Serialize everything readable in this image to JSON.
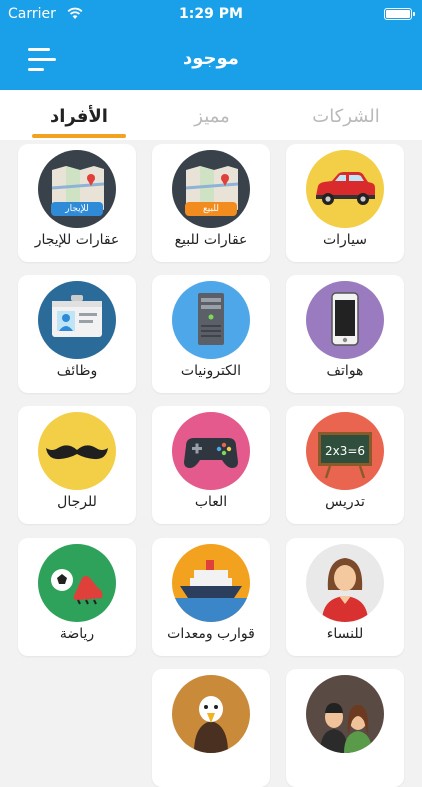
{
  "status_bar": {
    "carrier": "Carrier",
    "time": "1:29 PM"
  },
  "navbar": {
    "title": "موجود"
  },
  "tabs": [
    {
      "label": "الشركات"
    },
    {
      "label": "مميز"
    },
    {
      "label": "الأفراد"
    }
  ],
  "categories": [
    {
      "label": "سيارات",
      "icon": "car-icon",
      "bg": "#f3cf47"
    },
    {
      "label": "عقارات للبيع",
      "icon": "map-for-sale-icon",
      "badge": "للبيع",
      "badge_color": "#f28c1f",
      "bg": "#39414b"
    },
    {
      "label": "عقارات للإيجار",
      "icon": "map-for-rent-icon",
      "badge": "للإيجار",
      "badge_color": "#2f8ad8",
      "bg": "#39414b"
    },
    {
      "label": "هواتف",
      "icon": "phone-icon",
      "bg": "#9a7bbf"
    },
    {
      "label": "الكترونيات",
      "icon": "computer-tower-icon",
      "bg": "#4ea7e8"
    },
    {
      "label": "وظائف",
      "icon": "id-card-icon",
      "bg": "#2b6b9a"
    },
    {
      "label": "تدريس",
      "icon": "chalkboard-icon",
      "board_text": "2x3=6",
      "bg": "#e9654f"
    },
    {
      "label": "العاب",
      "icon": "gamepad-icon",
      "bg": "#e45a8c"
    },
    {
      "label": "للرجال",
      "icon": "mustache-icon",
      "bg": "#f3cf47"
    },
    {
      "label": "للنساء",
      "icon": "woman-icon",
      "bg": "#e9e9e9"
    },
    {
      "label": "قوارب ومعدات",
      "icon": "ship-icon",
      "bg": "#f3a21f"
    },
    {
      "label": "رياضة",
      "icon": "football-boot-icon",
      "bg": "#2ea15a"
    },
    {
      "label": "",
      "icon": "couple-icon",
      "bg": "#5a4a44"
    },
    {
      "label": "",
      "icon": "eagle-icon",
      "bg": "#c98a3a"
    }
  ]
}
